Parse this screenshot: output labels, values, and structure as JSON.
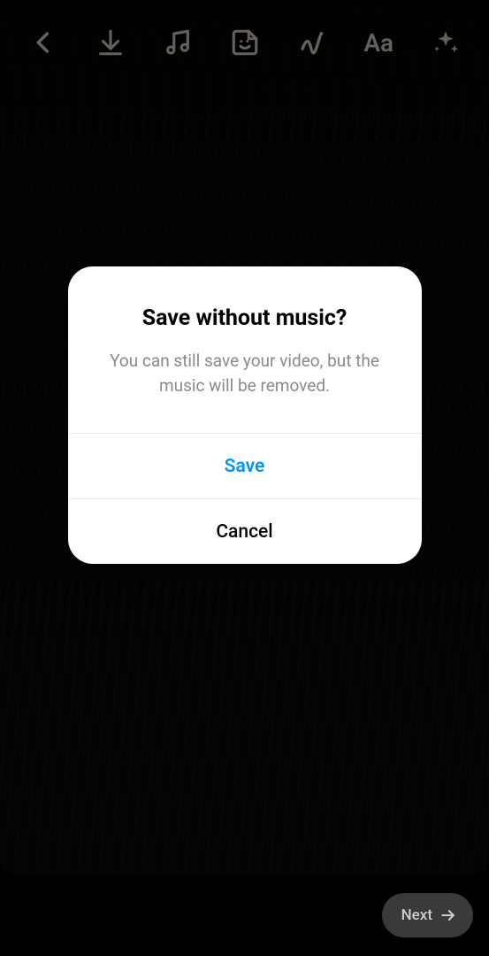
{
  "toolbar": {
    "back_name": "back",
    "download_name": "download",
    "music_name": "music",
    "sticker_name": "sticker",
    "effects_name": "effects",
    "text_name": "text",
    "text_glyph": "Aa",
    "sparkle_name": "sparkle"
  },
  "dialog": {
    "title": "Save without music?",
    "message": "You can still save your video, but the music will be removed.",
    "save": "Save",
    "cancel": "Cancel"
  },
  "bottom": {
    "next": "Next"
  }
}
